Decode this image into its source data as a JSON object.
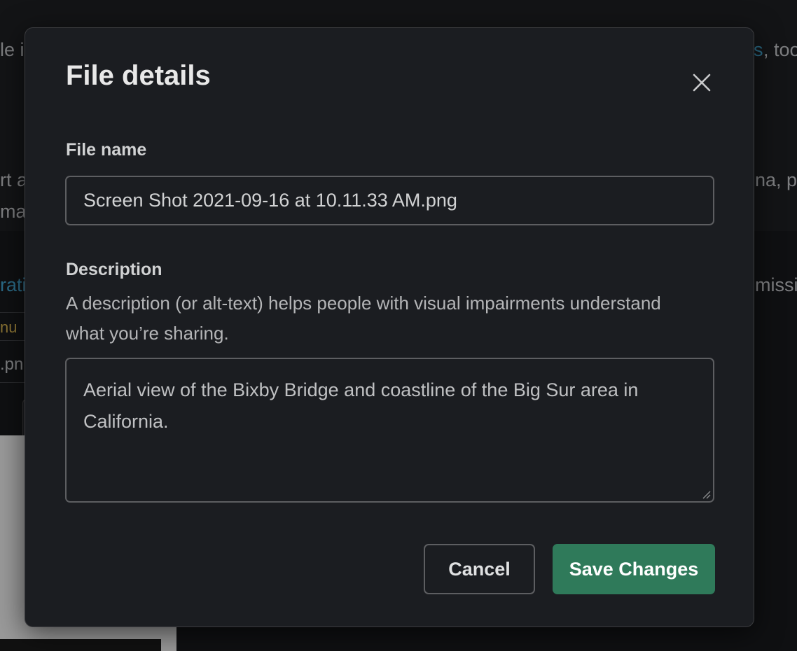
{
  "background": {
    "fragments": {
      "line1_left": "le i",
      "line1_link": "s",
      "line1_right": ", too",
      "line2_left": "rt a",
      "line2_right": "na, plo",
      "line3_left": "ma",
      "line4_left": "rati",
      "line4_right": "missi",
      "line5_left": "nu",
      "line6_left": ".pn"
    }
  },
  "modal": {
    "title": "File details",
    "file_name": {
      "label": "File name",
      "value": "Screen Shot 2021-09-16 at 10.11.33 AM.png"
    },
    "description": {
      "label": "Description",
      "helper": "A description (or alt-text) helps people with visual impairments understand what you’re sharing.",
      "value": "Aerial view of the Bixby Bridge and coastline of the Big Sur area in California."
    },
    "buttons": {
      "cancel": "Cancel",
      "save": "Save Changes"
    }
  },
  "colors": {
    "modal_bg": "#1b1d21",
    "save_button": "#2f7a5a",
    "link": "#2a6a86",
    "border": "#5d5e61"
  },
  "icons": {
    "close": "close-icon"
  }
}
